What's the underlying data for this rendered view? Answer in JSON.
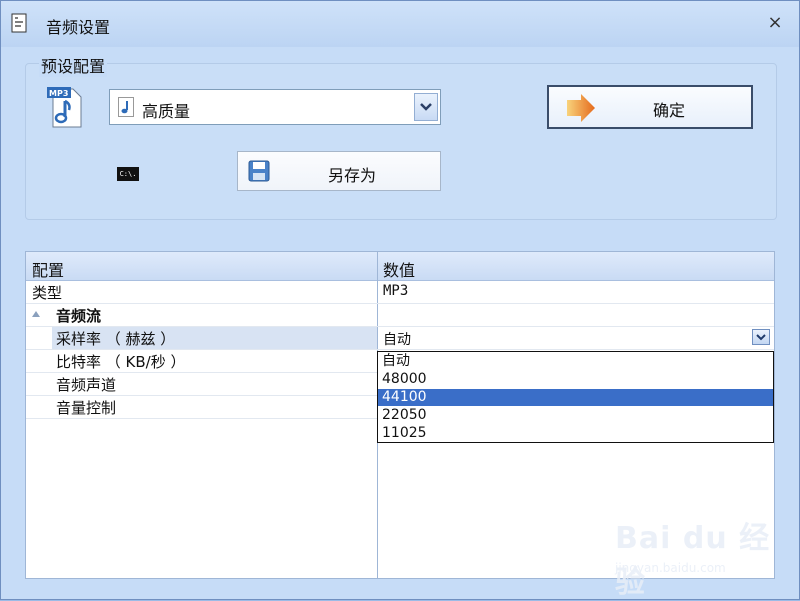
{
  "window": {
    "title": "音频设置",
    "close_glyph": "×"
  },
  "preset_group": {
    "title": "预设配置",
    "selected_preset": "高质量",
    "ok_label": "确定",
    "saveas_label": "另存为",
    "cmd_icon_text": "C:\\."
  },
  "grid": {
    "columns": [
      "配置",
      "数值"
    ],
    "rows": {
      "type": {
        "label": "类型",
        "value": "MP3"
      },
      "category": {
        "label": "音频流"
      },
      "sample_rate": {
        "label": "采样率 （ 赫兹 ）",
        "value": "自动"
      },
      "bit_rate": {
        "label": "比特率 （ KB/秒 ）"
      },
      "channel": {
        "label": "音频声道"
      },
      "volume": {
        "label": "音量控制"
      }
    },
    "dropdown": {
      "options": [
        "自动",
        "48000",
        "44100",
        "22050",
        "11025"
      ],
      "selected": "44100"
    }
  },
  "watermark": {
    "logo": "Bai du 经验",
    "sub": "jingyan.baidu.com"
  },
  "colors": {
    "accent": "#3a6ec8",
    "window_bg": "#c6dcf7"
  }
}
